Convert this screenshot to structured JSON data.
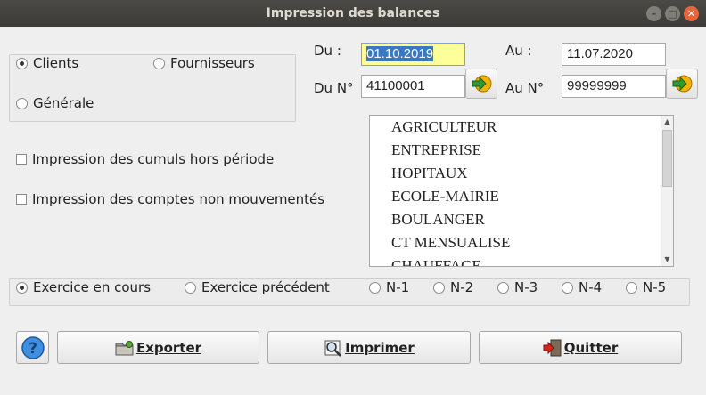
{
  "window": {
    "title": "Impression des balances"
  },
  "tiers": {
    "clients": "Clients",
    "fournisseurs": "Fournisseurs",
    "generale": "Générale",
    "selected": "clients"
  },
  "options": {
    "cumuls": "Impression des cumuls hors période",
    "non_mouvementes": "Impression des comptes non mouvementés"
  },
  "period": {
    "du_label": "Du :",
    "du_value": "01.10.2019",
    "au_label": "Au :",
    "au_value": "11.07.2020",
    "du_no_label": "Du N°",
    "du_no_value": "41100001",
    "au_no_label": "Au N°",
    "au_no_value": "99999999"
  },
  "categories": [
    "AGRICULTEUR",
    "ENTREPRISE",
    "HOPITAUX",
    "ECOLE-MAIRIE",
    "BOULANGER",
    "CT MENSUALISE",
    "CHAUFFAGE"
  ],
  "exercice": {
    "en_cours": "Exercice en cours",
    "precedent": "Exercice précédent",
    "n1": "N-1",
    "n2": "N-2",
    "n3": "N-3",
    "n4": "N-4",
    "n5": "N-5",
    "selected": "en_cours"
  },
  "buttons": {
    "exporter": "Exporter",
    "imprimer": "Imprimer",
    "quitter": "Quitter"
  },
  "icons": {
    "help": "help-icon",
    "export": "folder-export-icon",
    "print": "print-preview-icon",
    "quit": "exit-door-icon",
    "go": "go-arrow-icon"
  }
}
